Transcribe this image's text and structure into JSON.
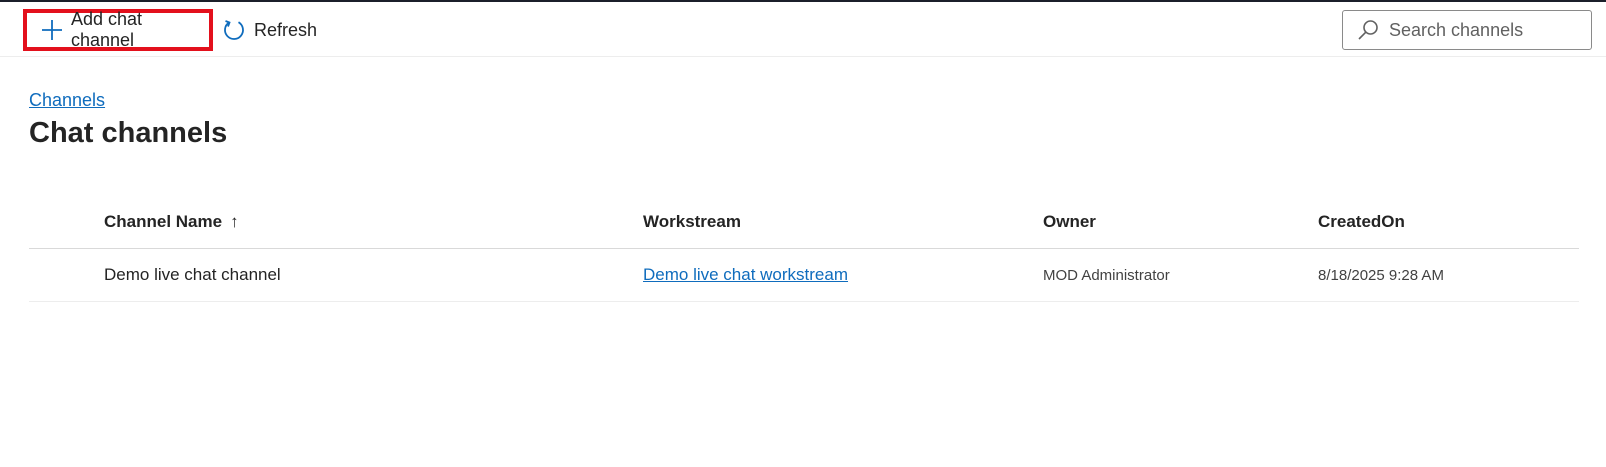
{
  "toolbar": {
    "add_label": "Add chat channel",
    "refresh_label": "Refresh",
    "search_placeholder": "Search channels"
  },
  "breadcrumb": "Channels",
  "page_title": "Chat channels",
  "table": {
    "columns": [
      "Channel Name",
      "Workstream",
      "Owner",
      "CreatedOn"
    ],
    "sort_indicator": "↑",
    "rows": [
      [
        "Demo live chat channel",
        "Demo live chat workstream",
        "MOD Administrator",
        "8/18/2025 9:28 AM"
      ]
    ]
  },
  "colors": {
    "accent": "#0f6cbd",
    "highlight": "#e3101c"
  }
}
